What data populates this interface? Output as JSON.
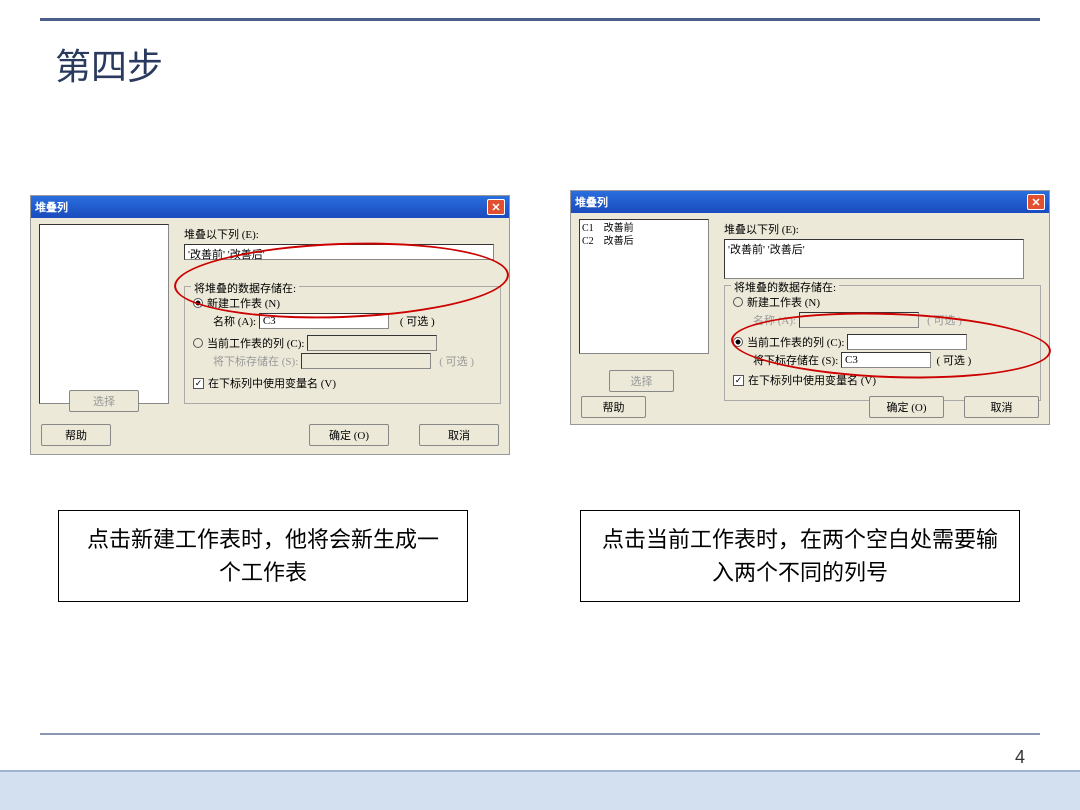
{
  "title": "第四步",
  "page": "4",
  "dialogA": {
    "title": "堆叠列",
    "label_stack": "堆叠以下列 (E):",
    "stack_value": "'改善前' '改善后'",
    "storage_legend": "将堆叠的数据存储在:",
    "radio_new": "新建工作表 (N)",
    "name_label": "名称 (A):",
    "name_value": "C3",
    "optional": "( 可选 )",
    "radio_current": "当前工作表的列 (C):",
    "store_sub": "将下标存储在 (S):",
    "optional2": "( 可选 )",
    "checkbox": "在下标列中使用变量名 (V)",
    "btn_select": "选择",
    "btn_help": "帮助",
    "btn_ok": "确定 (O)",
    "btn_cancel": "取消"
  },
  "dialogB": {
    "title": "堆叠列",
    "list": "C1    改善前\nC2    改善后",
    "label_stack": "堆叠以下列 (E):",
    "stack_value": "'改善前' '改善后'",
    "storage_legend": "将堆叠的数据存储在:",
    "radio_new": "新建工作表 (N)",
    "name_label": "名称 (A):",
    "optional": "( 可选 )",
    "radio_current": "当前工作表的列 (C):",
    "store_sub": "将下标存储在 (S):",
    "sub_value": "C3",
    "optional2": "( 可选 )",
    "checkbox": "在下标列中使用变量名 (V)",
    "btn_select": "选择",
    "btn_help": "帮助",
    "btn_ok": "确定 (O)",
    "btn_cancel": "取消"
  },
  "captionA": "点击新建工作表时，他将会新生成一个工作表",
  "captionB": "点击当前工作表时，在两个空白处需要输入两个不同的列号"
}
